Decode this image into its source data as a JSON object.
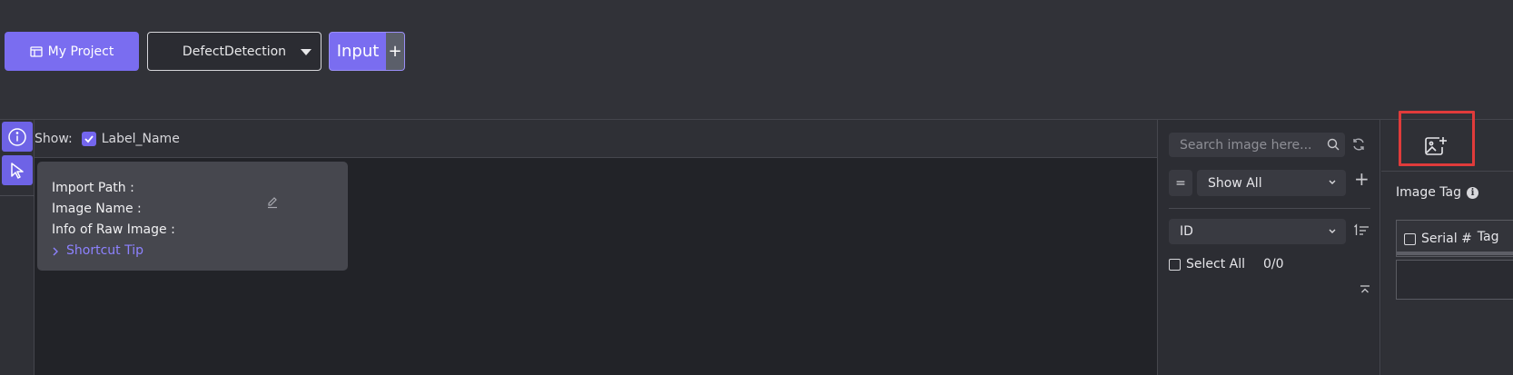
{
  "toolbar": {
    "project_label": "My Project",
    "project_icon": "project-icon",
    "selected_project": "DefectDetection",
    "input_label": "Input",
    "input_add": "+"
  },
  "left_rail": {
    "info_icon": "info-icon",
    "select_icon": "cursor-icon"
  },
  "show_row": {
    "show_label": "Show:",
    "label_name": "Label_Name",
    "label_checked": true
  },
  "info_card": {
    "import_path": "Import Path :",
    "image_name": "Image Name :",
    "raw_info": "Info of Raw Image :",
    "shortcut_tip": "Shortcut Tip"
  },
  "image_list": {
    "search_placeholder": "Search image here...",
    "filter_operator": "=",
    "filter_value": "Show All",
    "sort_field": "ID",
    "select_all_label": "Select All",
    "count": "0/0"
  },
  "right_panel": {
    "image_tag_label": "Image Tag",
    "info_badge": "i",
    "col_serial": "Serial #",
    "col_tag": "Tag"
  },
  "colors": {
    "accent": "#7a6df0",
    "highlight_box": "#e03b3b"
  }
}
